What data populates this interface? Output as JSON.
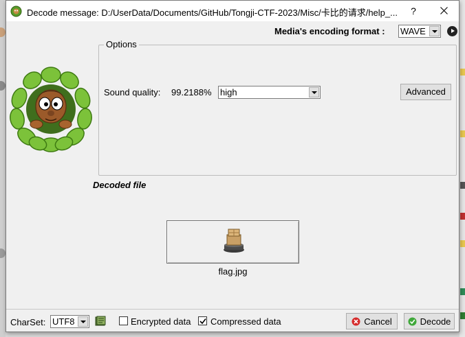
{
  "window": {
    "title": "Decode message: D:/UserData/Documents/GitHub/Tongji-CTF-2023/Misc/卡比的请求/help_...",
    "help_glyph": "?",
    "close_icon": "close-icon",
    "app_icon": "green-gear-icon"
  },
  "encoding": {
    "label": "Media's encoding format :",
    "selected": "WAVE",
    "play_icon": "play-icon"
  },
  "options": {
    "legend": "Options",
    "sound_quality_label": "Sound quality:",
    "sound_quality_value": "99.2188%",
    "quality_selected": "high",
    "advanced_label": "Advanced"
  },
  "decoded": {
    "section_label": "Decoded file",
    "file_name": "flag.jpg",
    "file_icon": "archive-box-icon"
  },
  "footer": {
    "charset_label": "CharSet:",
    "charset_selected": "UTF8",
    "encrypted_label": "Encrypted data",
    "encrypted_checked": false,
    "compressed_label": "Compressed data",
    "compressed_checked": true,
    "cancel_label": "Cancel",
    "decode_label": "Decode"
  },
  "colors": {
    "window_bg": "#f0f0f0",
    "button_bg": "#e1e1e1",
    "cancel_icon": "#d62b2b",
    "decode_icon": "#3fa83a"
  }
}
